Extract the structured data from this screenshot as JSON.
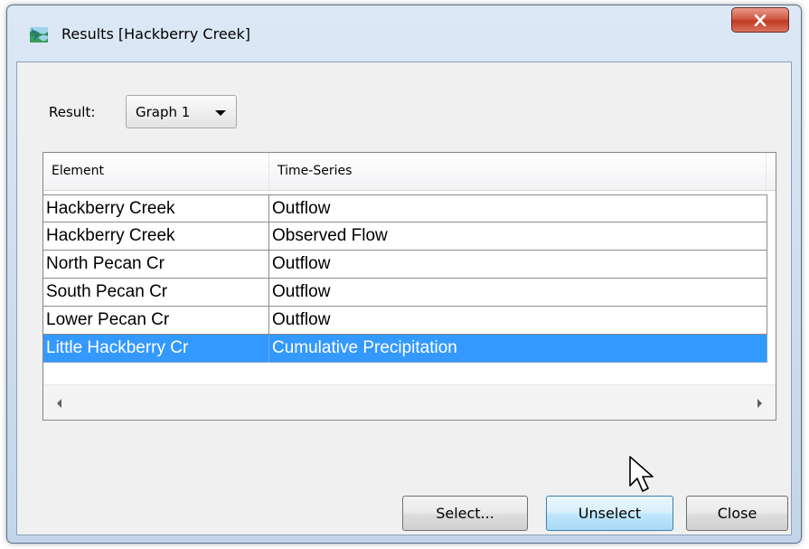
{
  "window": {
    "title": "Results [Hackberry Creek]",
    "app_icon": "hms-watershed-icon",
    "close_icon": "close-x-icon"
  },
  "result": {
    "label": "Result:",
    "selected": "Graph 1"
  },
  "table": {
    "columns": [
      "Element",
      "Time-Series"
    ],
    "rows": [
      {
        "element": "Hackberry Creek",
        "series": "Outflow"
      },
      {
        "element": "Hackberry Creek",
        "series": "Observed Flow"
      },
      {
        "element": "North Pecan Cr",
        "series": "Outflow"
      },
      {
        "element": "South Pecan Cr",
        "series": "Outflow"
      },
      {
        "element": "Lower Pecan Cr",
        "series": "Outflow"
      },
      {
        "element": "Little Hackberry Cr",
        "series": "Cumulative Precipitation"
      }
    ],
    "selected_row_index": 5,
    "selection_color": "#3399ff"
  },
  "buttons": {
    "select": "Select...",
    "unselect": "Unselect",
    "close": "Close"
  },
  "colors": {
    "window_frame": "#c3d5ea",
    "close_button": "#c9483a"
  }
}
